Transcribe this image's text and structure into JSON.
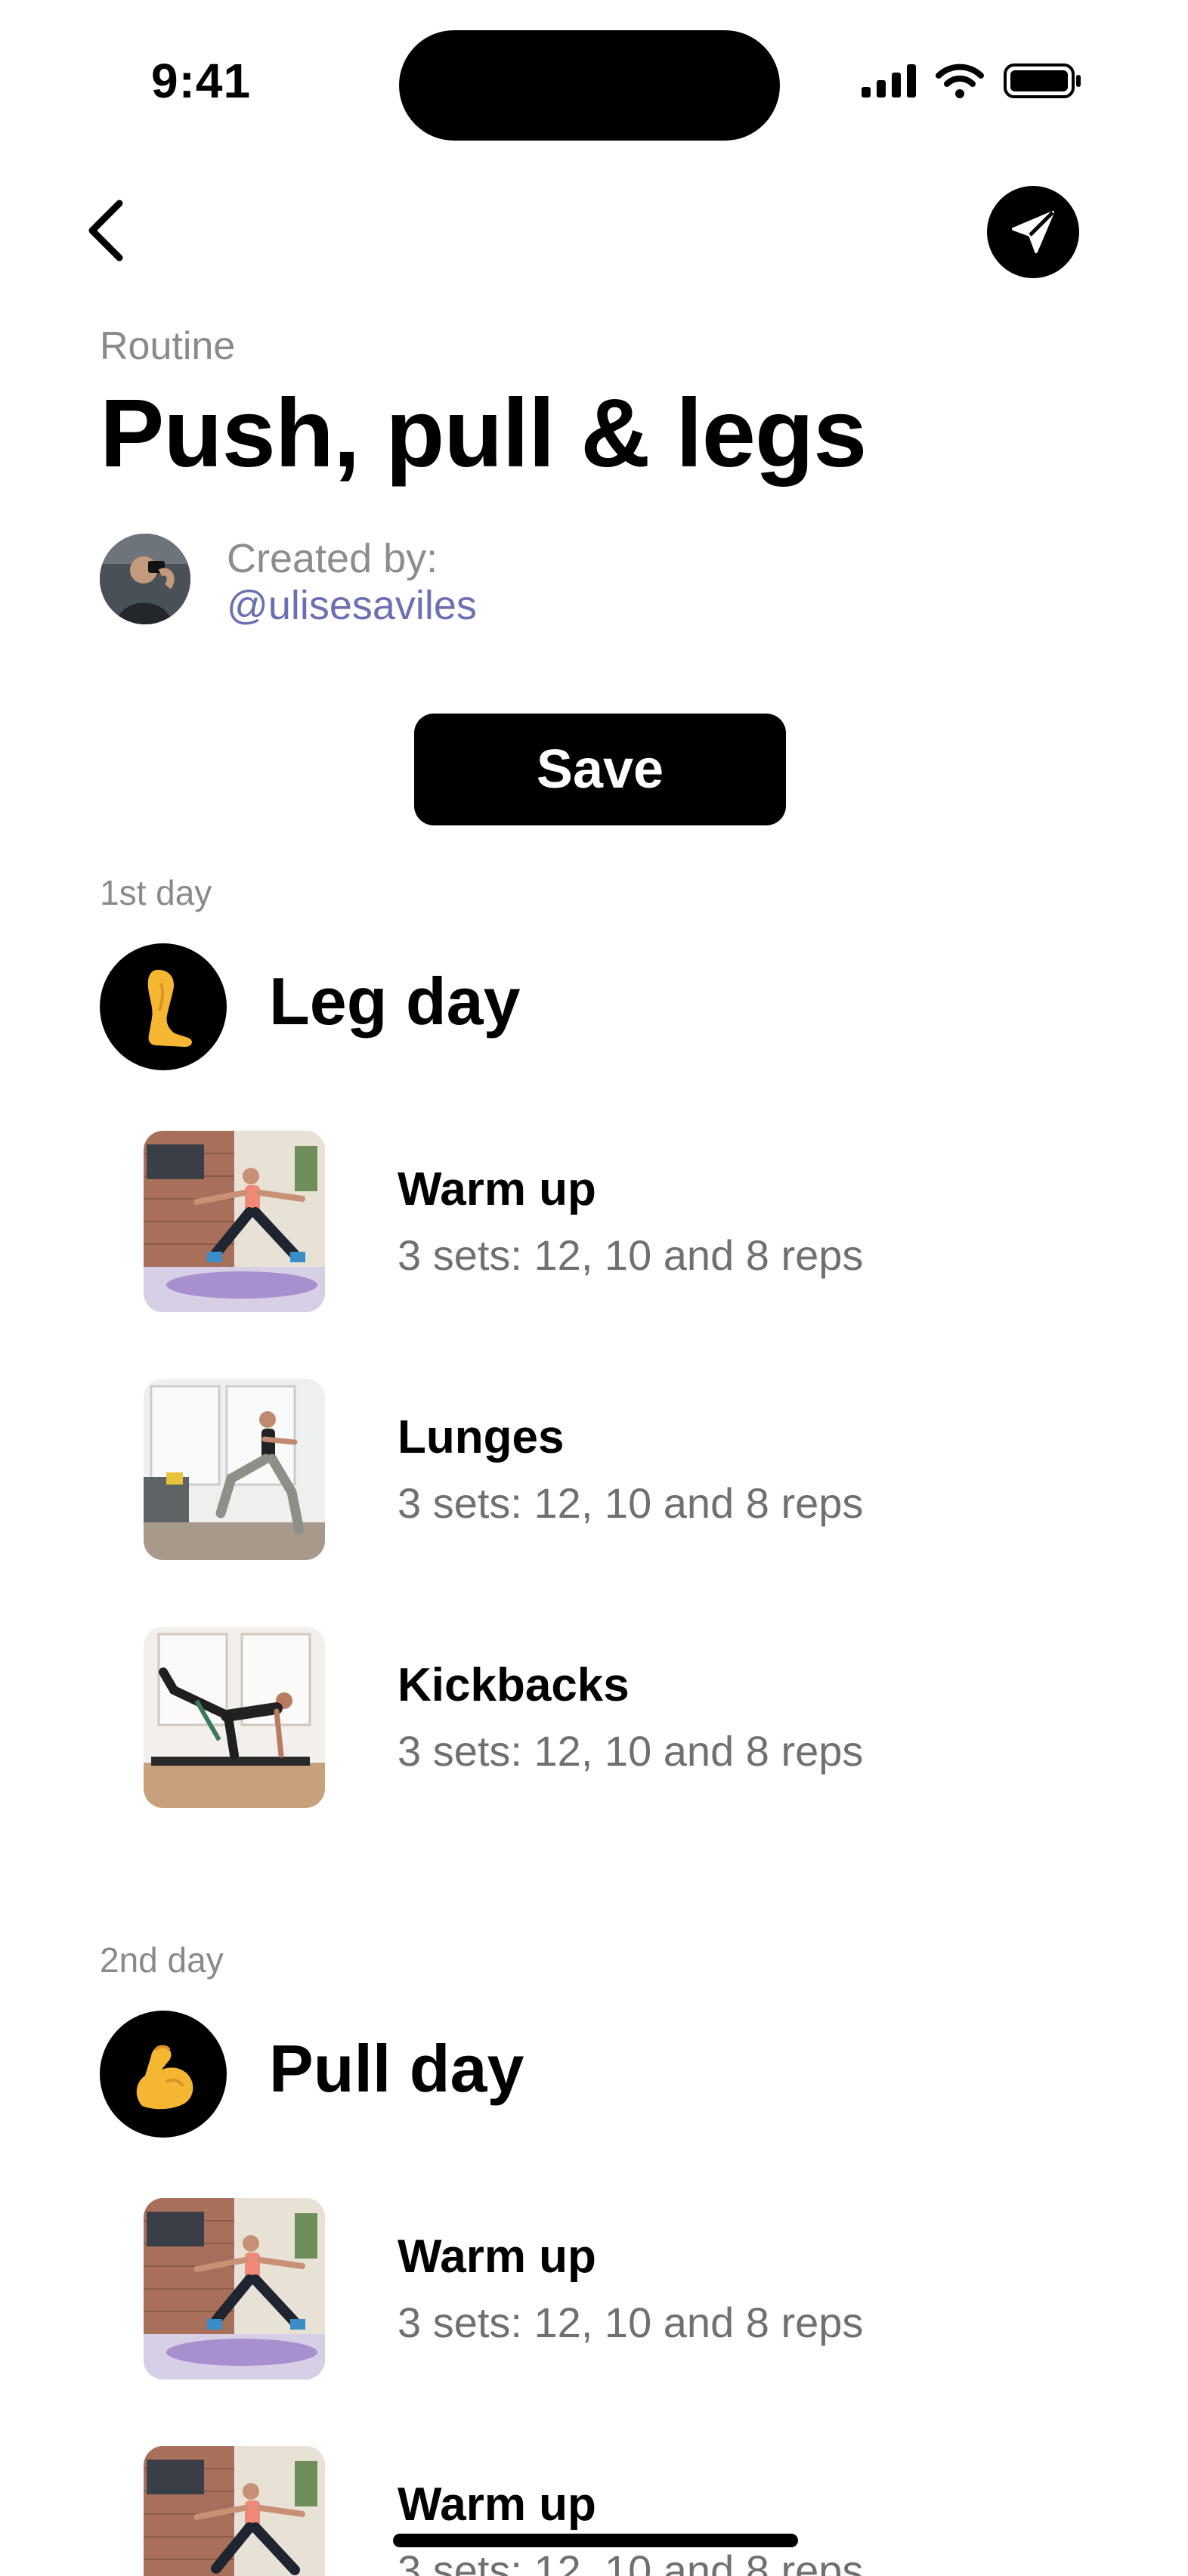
{
  "status_bar": {
    "time": "9:41"
  },
  "header": {
    "kicker": "Routine",
    "title": "Push, pull & legs"
  },
  "creator": {
    "label": "Created by:",
    "handle": "@ulisesaviles"
  },
  "save_label": "Save",
  "days": [
    {
      "kicker": "1st day",
      "title": "Leg day",
      "icon": "leg-icon",
      "exercises": [
        {
          "name": "Warm up",
          "detail": "3 sets: 12, 10 and 8 reps",
          "thumb": "warm-up-photo"
        },
        {
          "name": "Lunges",
          "detail": "3 sets: 12, 10 and 8 reps",
          "thumb": "lunges-photo"
        },
        {
          "name": "Kickbacks",
          "detail": "3 sets: 12, 10 and 8 reps",
          "thumb": "kickbacks-photo"
        }
      ]
    },
    {
      "kicker": "2nd day",
      "title": "Pull day",
      "icon": "flexed-biceps-icon",
      "exercises": [
        {
          "name": "Warm up",
          "detail": "3 sets: 12, 10 and 8 reps",
          "thumb": "warm-up-photo"
        },
        {
          "name": "Warm up",
          "detail": "3 sets: 12, 10 and 8 reps",
          "thumb": "warm-up-photo"
        }
      ]
    }
  ],
  "colors": {
    "accent": "#6c6fb3",
    "icon_fill": "#f5b731",
    "muted_text": "#707070"
  }
}
